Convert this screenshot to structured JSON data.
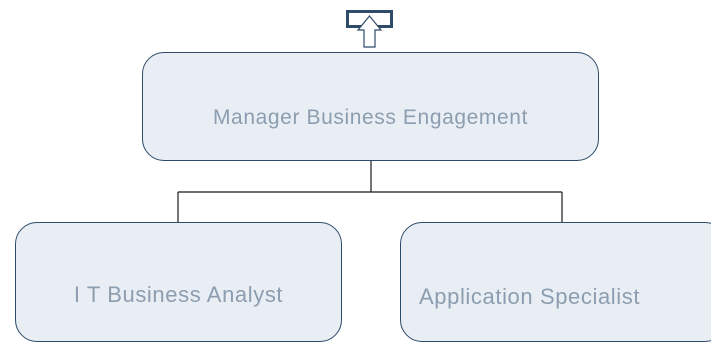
{
  "diagram": {
    "type": "org-chart",
    "nodes": {
      "manager": {
        "label": "Manager Business Engagement"
      },
      "analyst": {
        "label": "I T Business Analyst"
      },
      "specialist": {
        "label": "Application Specialist"
      }
    },
    "edges": [
      {
        "from": "manager",
        "to": "analyst"
      },
      {
        "from": "manager",
        "to": "specialist"
      }
    ],
    "parent_link_icon": "up-arrow-icon",
    "colors": {
      "node_fill": "#e9eef4",
      "node_border": "#2e4b6a",
      "node_text": "#8c9db0",
      "connector": "#1a1a1a",
      "arrow": "#2e4b6a"
    }
  }
}
